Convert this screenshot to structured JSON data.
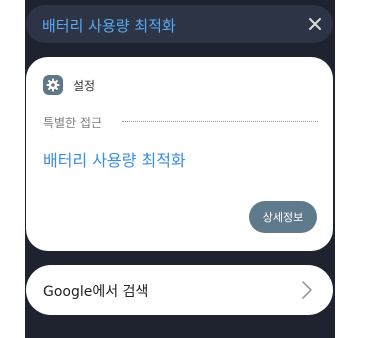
{
  "search": {
    "query": "배터리 사용량 최적화"
  },
  "result_card": {
    "app_name": "설정",
    "section_label": "특별한 접근",
    "title": "배터리 사용량 최적화",
    "detail_button": "상세정보"
  },
  "web_search": {
    "label": "Google에서 검색"
  },
  "colors": {
    "background": "#1f2330",
    "search_bar": "#2d3445",
    "accent_blue": "#3a8ee0",
    "button": "#5f7a8c"
  },
  "icons": [
    "close-icon",
    "settings-gear-icon",
    "chevron-right-icon"
  ]
}
